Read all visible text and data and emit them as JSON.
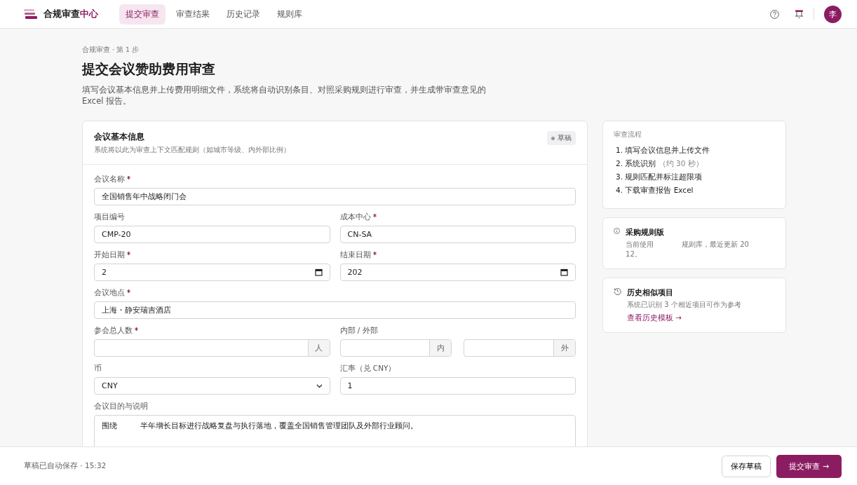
{
  "app": {
    "name": "合规审查",
    "name_accent": "中心",
    "avatar": "李"
  },
  "nav": [
    {
      "label": "提交审查",
      "selected": true
    },
    {
      "label": "审查结果",
      "selected": false
    },
    {
      "label": "历史记录",
      "selected": false
    },
    {
      "label": "规则库",
      "selected": false
    }
  ],
  "breadcrumb": "合规审查 · 第 1 步",
  "title": "提交会议赞助费用审查",
  "intro": "填写会议基本信息并上传费用明细文件，系统将自动识别条目、对照采购规则进行审查，并生成带审查意见的 Excel 报告。",
  "form": {
    "title": "会议基本信息",
    "subtitle": "系统将以此为审查上下文匹配规则（如城市等级、内外部比例）",
    "status": "草稿",
    "rows": [
      [
        {
          "kind": "text",
          "label": "会议名称",
          "required": true,
          "value": "全国销售年中战略闭门会"
        }
      ],
      [
        {
          "kind": "text",
          "label": "项目编号",
          "required": false,
          "value": "CMP-20"
        },
        {
          "kind": "text",
          "label": "成本中心",
          "required": true,
          "value": "CN-SA"
        }
      ],
      [
        {
          "kind": "date",
          "label": "开始日期",
          "required": true,
          "value": "2"
        },
        {
          "kind": "date",
          "label": "结束日期",
          "required": true,
          "value": "202"
        }
      ],
      [
        {
          "kind": "text",
          "label": "会议地点",
          "required": true,
          "value": "上海・静安瑞吉酒店"
        }
      ],
      [
        {
          "kind": "unit",
          "label": "参会总人数",
          "required": true,
          "units": [
            "人"
          ]
        },
        {
          "kind": "unit",
          "label": "内部 / 外部",
          "required": false,
          "units": [
            "内",
            "外"
          ]
        }
      ],
      [
        {
          "kind": "select",
          "label": "币",
          "required": false,
          "value": "CNY"
        },
        {
          "kind": "text",
          "label": "汇率（兑 CNY）",
          "required": false,
          "value": "1"
        }
      ],
      [
        {
          "kind": "textarea",
          "label": "会议目的与说明",
          "required": false,
          "value": "围绕　　　半年增长目标进行战略复盘与执行落地，覆盖全国销售管理团队及外部行业顾问。"
        }
      ]
    ]
  },
  "process": {
    "title": "审查流程",
    "steps": [
      "1. 填写会议信息并上传文件",
      "2. 系统识别",
      "3. 规则匹配并标注超限项",
      "4. 下载审查报告 Excel"
    ],
    "step_note": "（约 30 秒）"
  },
  "info_cards": [
    {
      "kind": "info",
      "title": "采购规则版",
      "text": "当前使用　　　　规则库，最近更新 20　　　　　　12。"
    },
    {
      "kind": "history",
      "title": "历史相似项目",
      "text": "系统已识别 3 个相近项目可作为参考",
      "link": "查看历史模板 →"
    }
  ],
  "footer": {
    "status": "草稿已自动保存 · 15:32",
    "save": "保存草稿",
    "submit": "提交审查 →"
  }
}
